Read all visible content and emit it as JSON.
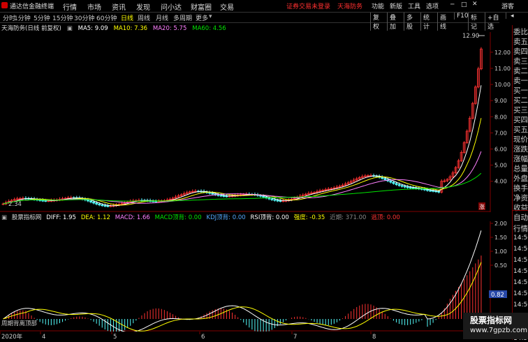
{
  "menubar": {
    "brand": "通达信金融终端",
    "menus": [
      "行情",
      "市场",
      "资讯",
      "发现",
      "问小达",
      "财富圈",
      "交易"
    ],
    "notice": "证券交易未登录",
    "stock_link": "天海防务",
    "right_items": [
      "功能",
      "新版",
      "工具",
      "选项",
      "游客"
    ]
  },
  "periods": [
    "分时",
    "1分钟",
    "5分钟",
    "15分钟",
    "30分钟",
    "60分钟",
    "日线",
    "周线",
    "月线",
    "多周期",
    "更多"
  ],
  "active_period": "日线",
  "toolbar": [
    "复权",
    "叠加",
    "多股",
    "统计",
    "画线",
    "F10",
    "标记",
    "+自选",
    "返回"
  ],
  "main_legend": {
    "title": "天海防务(日线 前复权)",
    "ma5": "MA5: 9.09",
    "ma10": "MA10: 7.36",
    "ma20": "MA20: 5.75",
    "ma60": "MA60: 4.56",
    "high_label": "12.90",
    "low_label": "2.34",
    "rise_badge": "涨"
  },
  "main_axis": [
    "12.00",
    "11.00",
    "10.00",
    "9.00",
    "8.00",
    "7.00",
    "6.00",
    "5.00",
    "4.00"
  ],
  "sub_legend": {
    "name": "股票指标网",
    "diff": "DIFF: 1.95",
    "dea": "DEA: 1.12",
    "macd": "MACD: 1.66",
    "macd_top": "MACD顶背: 0.00",
    "kdj_top": "KDJ顶背: 0.00",
    "rsi_top": "RSI顶背: 0.00",
    "strength": "强度: -0.35",
    "recent": "近期: 371.00",
    "escape": "逃顶: 0.00",
    "bottom_text": "周期背离顶部"
  },
  "sub_axis": [
    "2.00",
    "1.50",
    "1.00",
    "0.50"
  ],
  "sub_current": "0.82",
  "x_axis": [
    "2020年",
    "4",
    "5",
    "6",
    "7",
    "8"
  ],
  "right_panel": [
    "委比",
    "卖五",
    "卖四",
    "卖三",
    "卖二",
    "卖一",
    "买一",
    "买二",
    "买三",
    "买四",
    "买五",
    "现价",
    "涨跌",
    "涨幅",
    "总量",
    "外盘",
    "换手",
    "净资",
    "收益",
    "自动",
    "行情",
    "14:50",
    "14:50",
    "14:50",
    "14:50",
    "14:50",
    "14:50",
    "14:50",
    "14:50",
    "14:50",
    "14:50",
    "14:50"
  ],
  "watermark": {
    "title": "股票指标网",
    "url": "www.7gpzb.com"
  },
  "colors": {
    "up": "#ff3232",
    "down": "#54fcfc",
    "ma5": "#ffffff",
    "ma10": "#ffff00",
    "ma20": "#ff80ff",
    "ma60": "#00e600"
  }
}
